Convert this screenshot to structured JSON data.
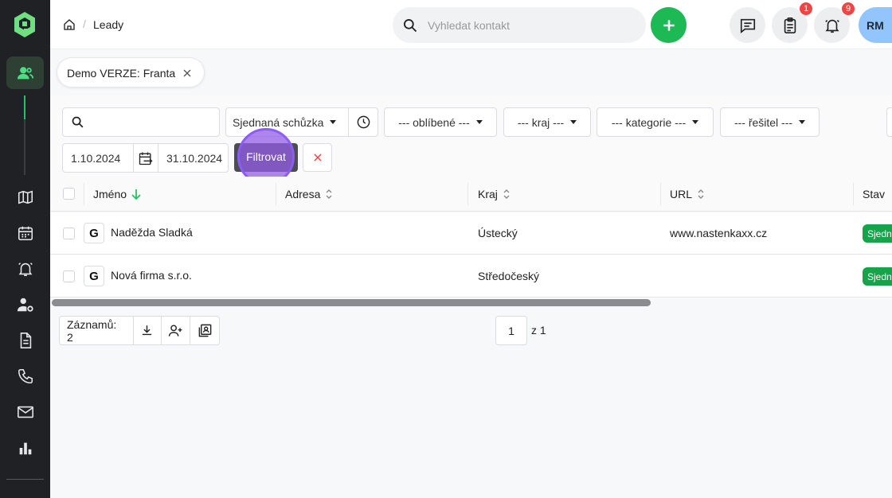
{
  "breadcrumb": {
    "current": "Leady"
  },
  "search": {
    "placeholder": "Vyhledat kontakt"
  },
  "header": {
    "tasks_badge": "1",
    "notifications_badge": "9",
    "avatar_initials": "RM"
  },
  "tab": {
    "label": "Demo VERZE: Franta"
  },
  "filters": {
    "status_select": "Sjednaná schůzka",
    "favorite_select": "--- oblíbené ---",
    "region_select": "--- kraj ---",
    "category_select": "--- kategorie ---",
    "solver_select": "--- řešitel ---",
    "date_from": "1.10.2024",
    "date_to": "31.10.2024",
    "filter_button": "Filtrovat"
  },
  "table": {
    "columns": [
      "Jméno",
      "Adresa",
      "Kraj",
      "URL",
      "Stav"
    ],
    "rows": [
      {
        "name": "Naděžda Sladká",
        "address": "",
        "region": "Ústecký",
        "url": "www.nastenkaxx.cz",
        "status": "Sjedn"
      },
      {
        "name": "Nová firma s.r.o.",
        "address": "",
        "region": "Středočeský",
        "url": "",
        "status": "Sjedn"
      }
    ]
  },
  "footer": {
    "records_label": "Záznamů: 2",
    "page": "1",
    "of_pages": "z 1"
  },
  "colors": {
    "accent": "#1db954",
    "sidebar_bg": "#1f2124",
    "badge": "#ef4444",
    "status": "#16a34a",
    "click_marker": "#8b5cf6"
  }
}
